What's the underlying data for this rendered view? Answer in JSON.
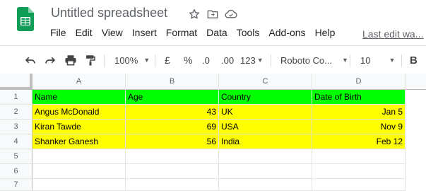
{
  "app": {
    "title": "Untitled spreadsheet",
    "menu": [
      "File",
      "Edit",
      "View",
      "Insert",
      "Format",
      "Data",
      "Tools",
      "Add-ons",
      "Help"
    ],
    "last_edit": "Last edit wa..."
  },
  "toolbar": {
    "zoom": "100%",
    "currency": "£",
    "percent": "%",
    "decrease_decimal": ".0",
    "increase_decimal": ".00",
    "more_formats": "123",
    "font": "Roboto Co...",
    "font_size": "10",
    "bold": "B"
  },
  "sheet": {
    "columns": [
      "A",
      "B",
      "C",
      "D"
    ],
    "rows": [
      "1",
      "2",
      "3",
      "4",
      "5",
      "6",
      "7"
    ],
    "header": [
      "Name",
      "Age",
      "Country",
      "Date of Birth"
    ],
    "data": [
      [
        "Angus McDonald",
        "43",
        "UK",
        "Jan 5"
      ],
      [
        "Kiran Tawde",
        "69",
        "USA",
        "Nov 9"
      ],
      [
        "Shanker Ganesh",
        "56",
        "India",
        "Feb 12"
      ]
    ]
  },
  "colors": {
    "header_fill": "#00ff00",
    "data_fill": "#ffff00",
    "sheets_green": "#0f9d58"
  }
}
